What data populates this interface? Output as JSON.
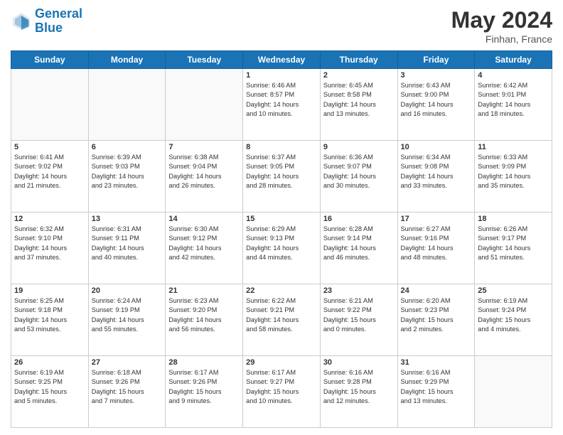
{
  "header": {
    "logo_line1": "General",
    "logo_line2": "Blue",
    "month_title": "May 2024",
    "location": "Finhan, France"
  },
  "days_of_week": [
    "Sunday",
    "Monday",
    "Tuesday",
    "Wednesday",
    "Thursday",
    "Friday",
    "Saturday"
  ],
  "weeks": [
    [
      {
        "day": "",
        "text": ""
      },
      {
        "day": "",
        "text": ""
      },
      {
        "day": "",
        "text": ""
      },
      {
        "day": "1",
        "text": "Sunrise: 6:46 AM\nSunset: 8:57 PM\nDaylight: 14 hours\nand 10 minutes."
      },
      {
        "day": "2",
        "text": "Sunrise: 6:45 AM\nSunset: 8:58 PM\nDaylight: 14 hours\nand 13 minutes."
      },
      {
        "day": "3",
        "text": "Sunrise: 6:43 AM\nSunset: 9:00 PM\nDaylight: 14 hours\nand 16 minutes."
      },
      {
        "day": "4",
        "text": "Sunrise: 6:42 AM\nSunset: 9:01 PM\nDaylight: 14 hours\nand 18 minutes."
      }
    ],
    [
      {
        "day": "5",
        "text": "Sunrise: 6:41 AM\nSunset: 9:02 PM\nDaylight: 14 hours\nand 21 minutes."
      },
      {
        "day": "6",
        "text": "Sunrise: 6:39 AM\nSunset: 9:03 PM\nDaylight: 14 hours\nand 23 minutes."
      },
      {
        "day": "7",
        "text": "Sunrise: 6:38 AM\nSunset: 9:04 PM\nDaylight: 14 hours\nand 26 minutes."
      },
      {
        "day": "8",
        "text": "Sunrise: 6:37 AM\nSunset: 9:05 PM\nDaylight: 14 hours\nand 28 minutes."
      },
      {
        "day": "9",
        "text": "Sunrise: 6:36 AM\nSunset: 9:07 PM\nDaylight: 14 hours\nand 30 minutes."
      },
      {
        "day": "10",
        "text": "Sunrise: 6:34 AM\nSunset: 9:08 PM\nDaylight: 14 hours\nand 33 minutes."
      },
      {
        "day": "11",
        "text": "Sunrise: 6:33 AM\nSunset: 9:09 PM\nDaylight: 14 hours\nand 35 minutes."
      }
    ],
    [
      {
        "day": "12",
        "text": "Sunrise: 6:32 AM\nSunset: 9:10 PM\nDaylight: 14 hours\nand 37 minutes."
      },
      {
        "day": "13",
        "text": "Sunrise: 6:31 AM\nSunset: 9:11 PM\nDaylight: 14 hours\nand 40 minutes."
      },
      {
        "day": "14",
        "text": "Sunrise: 6:30 AM\nSunset: 9:12 PM\nDaylight: 14 hours\nand 42 minutes."
      },
      {
        "day": "15",
        "text": "Sunrise: 6:29 AM\nSunset: 9:13 PM\nDaylight: 14 hours\nand 44 minutes."
      },
      {
        "day": "16",
        "text": "Sunrise: 6:28 AM\nSunset: 9:14 PM\nDaylight: 14 hours\nand 46 minutes."
      },
      {
        "day": "17",
        "text": "Sunrise: 6:27 AM\nSunset: 9:16 PM\nDaylight: 14 hours\nand 48 minutes."
      },
      {
        "day": "18",
        "text": "Sunrise: 6:26 AM\nSunset: 9:17 PM\nDaylight: 14 hours\nand 51 minutes."
      }
    ],
    [
      {
        "day": "19",
        "text": "Sunrise: 6:25 AM\nSunset: 9:18 PM\nDaylight: 14 hours\nand 53 minutes."
      },
      {
        "day": "20",
        "text": "Sunrise: 6:24 AM\nSunset: 9:19 PM\nDaylight: 14 hours\nand 55 minutes."
      },
      {
        "day": "21",
        "text": "Sunrise: 6:23 AM\nSunset: 9:20 PM\nDaylight: 14 hours\nand 56 minutes."
      },
      {
        "day": "22",
        "text": "Sunrise: 6:22 AM\nSunset: 9:21 PM\nDaylight: 14 hours\nand 58 minutes."
      },
      {
        "day": "23",
        "text": "Sunrise: 6:21 AM\nSunset: 9:22 PM\nDaylight: 15 hours\nand 0 minutes."
      },
      {
        "day": "24",
        "text": "Sunrise: 6:20 AM\nSunset: 9:23 PM\nDaylight: 15 hours\nand 2 minutes."
      },
      {
        "day": "25",
        "text": "Sunrise: 6:19 AM\nSunset: 9:24 PM\nDaylight: 15 hours\nand 4 minutes."
      }
    ],
    [
      {
        "day": "26",
        "text": "Sunrise: 6:19 AM\nSunset: 9:25 PM\nDaylight: 15 hours\nand 5 minutes."
      },
      {
        "day": "27",
        "text": "Sunrise: 6:18 AM\nSunset: 9:26 PM\nDaylight: 15 hours\nand 7 minutes."
      },
      {
        "day": "28",
        "text": "Sunrise: 6:17 AM\nSunset: 9:26 PM\nDaylight: 15 hours\nand 9 minutes."
      },
      {
        "day": "29",
        "text": "Sunrise: 6:17 AM\nSunset: 9:27 PM\nDaylight: 15 hours\nand 10 minutes."
      },
      {
        "day": "30",
        "text": "Sunrise: 6:16 AM\nSunset: 9:28 PM\nDaylight: 15 hours\nand 12 minutes."
      },
      {
        "day": "31",
        "text": "Sunrise: 6:16 AM\nSunset: 9:29 PM\nDaylight: 15 hours\nand 13 minutes."
      },
      {
        "day": "",
        "text": ""
      }
    ]
  ]
}
